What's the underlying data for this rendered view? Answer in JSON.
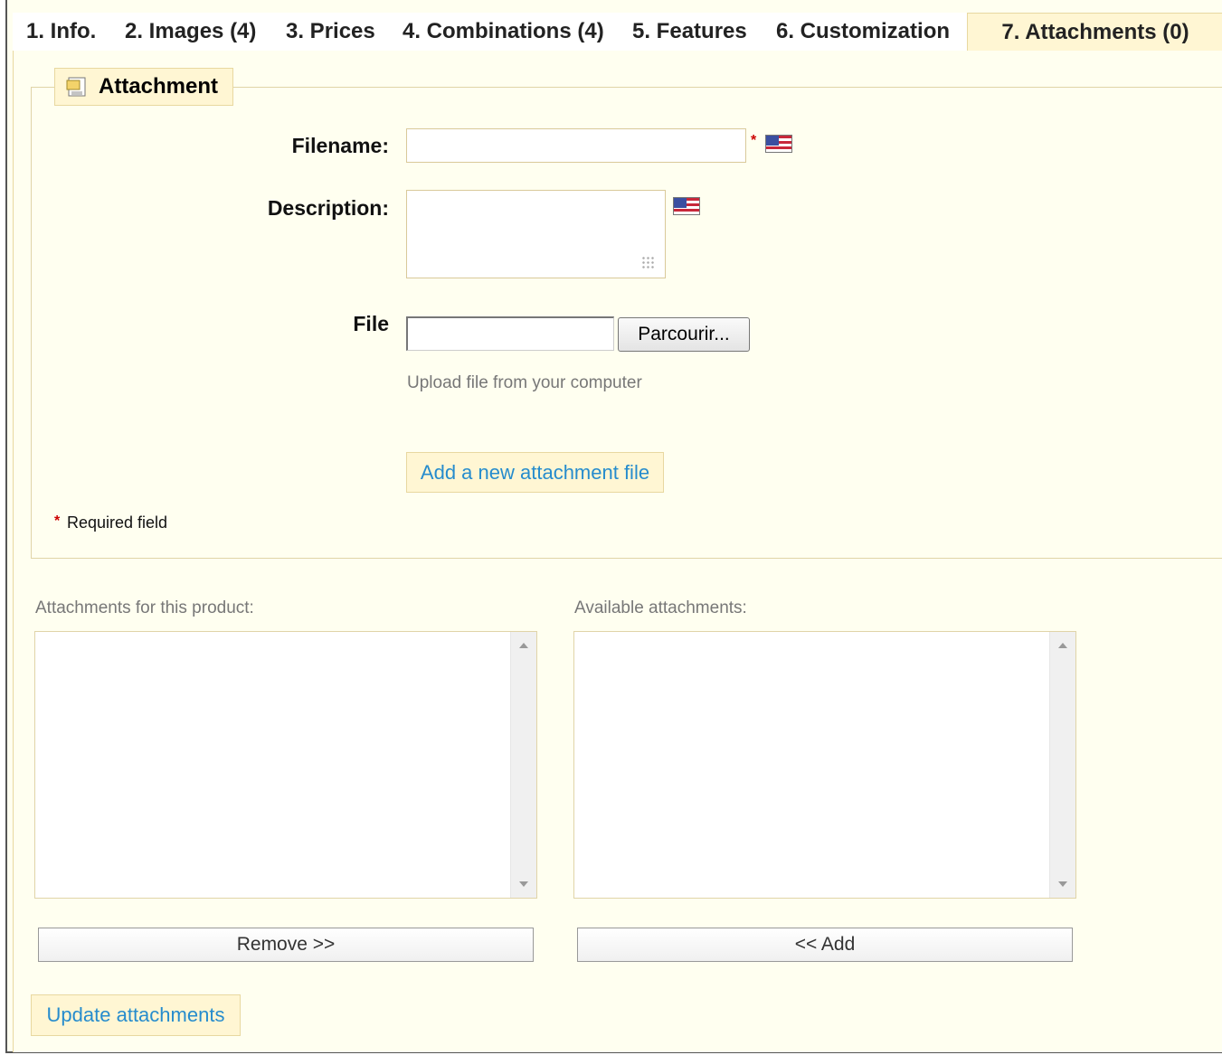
{
  "tabs": [
    {
      "label": "1. Info."
    },
    {
      "label": "2. Images (4)"
    },
    {
      "label": "3. Prices"
    },
    {
      "label": "4. Combinations (4)"
    },
    {
      "label": "5. Features"
    },
    {
      "label": "6. Customization"
    },
    {
      "label": "7. Attachments (0)",
      "active": true
    }
  ],
  "attachment_form": {
    "legend": "Attachment",
    "filename_label": "Filename:",
    "filename_value": "",
    "description_label": "Description:",
    "description_value": "",
    "file_label": "File",
    "browse_label": "Parcourir...",
    "upload_hint": "Upload file from your computer",
    "add_button": "Add a new attachment file",
    "required_star": "*",
    "required_note": "Required field",
    "language_icon": "us-flag-icon"
  },
  "attachment_lists": {
    "current_label": "Attachments for this product:",
    "current_items": [],
    "available_label": "Available attachments:",
    "available_items": [],
    "remove_button": "Remove >>",
    "add_button": "<< Add",
    "update_button": "Update attachments"
  },
  "colors": {
    "accent_link": "#268ccd",
    "panel_bg": "#fffff0",
    "tab_active_bg": "#fff6d3",
    "border": "#e0d4a8",
    "required": "#cc0000"
  }
}
